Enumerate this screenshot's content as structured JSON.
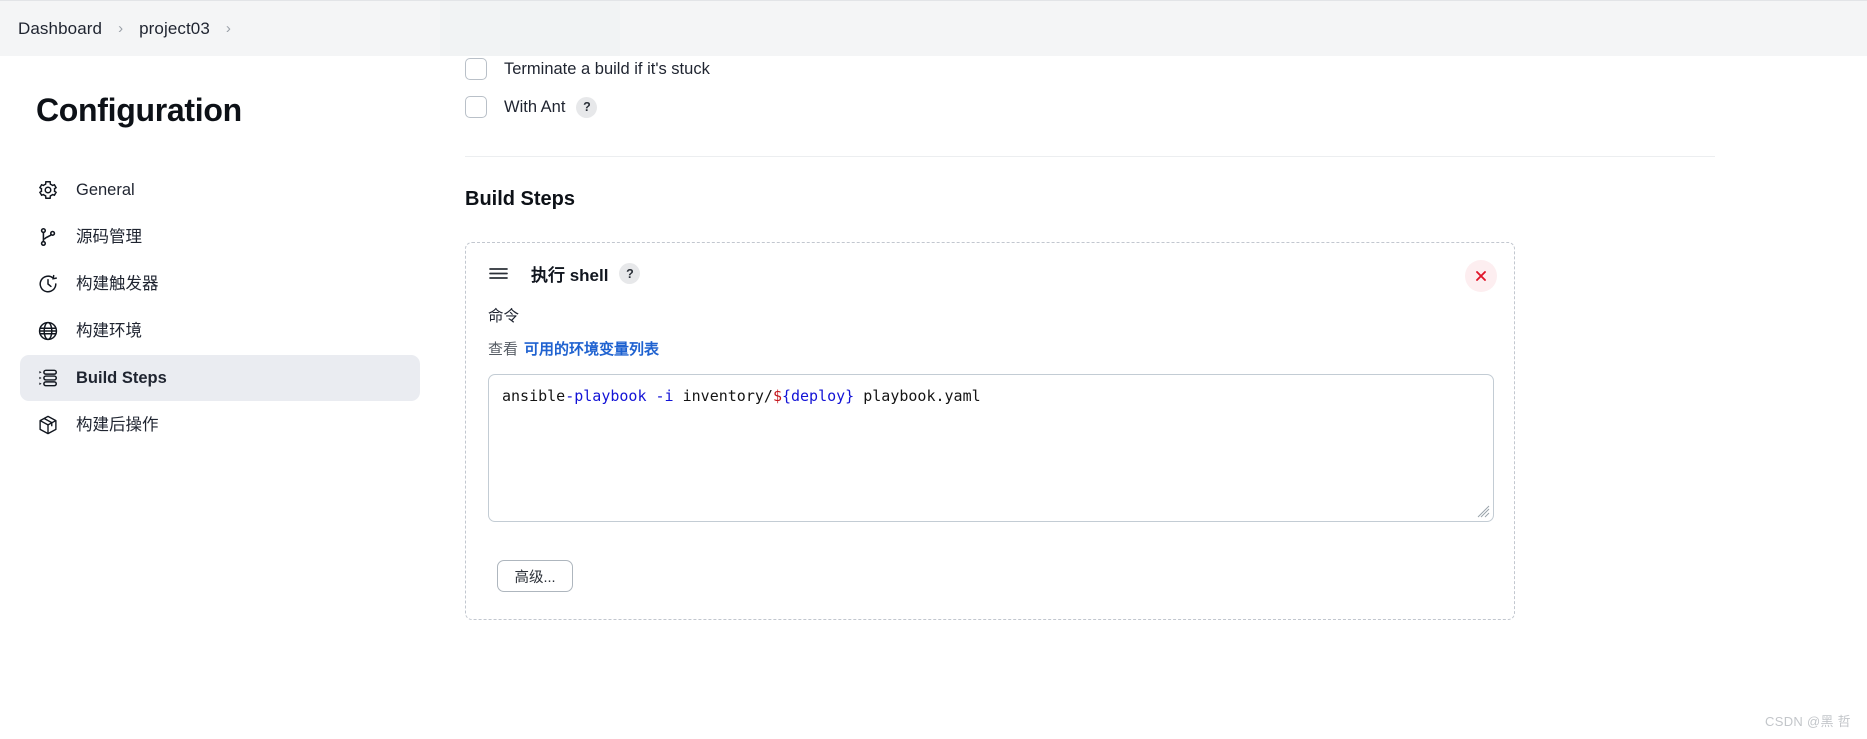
{
  "breadcrumb": {
    "items": [
      {
        "label": "Dashboard"
      },
      {
        "label": "project03"
      }
    ],
    "separator": "›"
  },
  "sidebar": {
    "title": "Configuration",
    "items": [
      {
        "label": "General",
        "icon": "gear-icon",
        "active": false
      },
      {
        "label": "源码管理",
        "icon": "source-branch-icon",
        "active": false
      },
      {
        "label": "构建触发器",
        "icon": "clock-icon",
        "active": false
      },
      {
        "label": "构建环境",
        "icon": "globe-icon",
        "active": false
      },
      {
        "label": "Build Steps",
        "icon": "list-steps-icon",
        "active": true
      },
      {
        "label": "构建后操作",
        "icon": "package-icon",
        "active": false
      }
    ]
  },
  "main": {
    "checkboxes": [
      {
        "label": "Terminate a build if it's stuck",
        "checked": false,
        "help": false
      },
      {
        "label": "With Ant",
        "checked": false,
        "help": true,
        "help_glyph": "?"
      }
    ],
    "section_title": "Build Steps",
    "step": {
      "title": "执行 shell",
      "help_glyph": "?",
      "close_glyph": "✕",
      "field_label": "命令",
      "env_prefix": "查看",
      "env_link": "可用的环境变量列表",
      "command_value": "ansible-playbook -i inventory/${deploy} playbook.yaml",
      "command_tokens": [
        {
          "text": "ansible",
          "color": "plain"
        },
        {
          "text": "-playbook",
          "color": "blue"
        },
        {
          "text": " ",
          "color": "plain"
        },
        {
          "text": "-i",
          "color": "blue"
        },
        {
          "text": " inventory/",
          "color": "plain"
        },
        {
          "text": "$",
          "color": "red"
        },
        {
          "text": "{deploy}",
          "color": "blue"
        },
        {
          "text": " playbook.yaml",
          "color": "plain"
        }
      ],
      "advanced_button": "高级..."
    }
  },
  "watermark": "CSDN @黑 哲",
  "colors": {
    "accent_link": "#1f62d0",
    "danger": "#e0152a",
    "danger_bg": "#fdeef0",
    "active_nav_bg": "#eaecf1",
    "breadcrumb_bg": "#f4f5f6",
    "token_blue": "#1313d6",
    "token_red": "#c4161c"
  }
}
